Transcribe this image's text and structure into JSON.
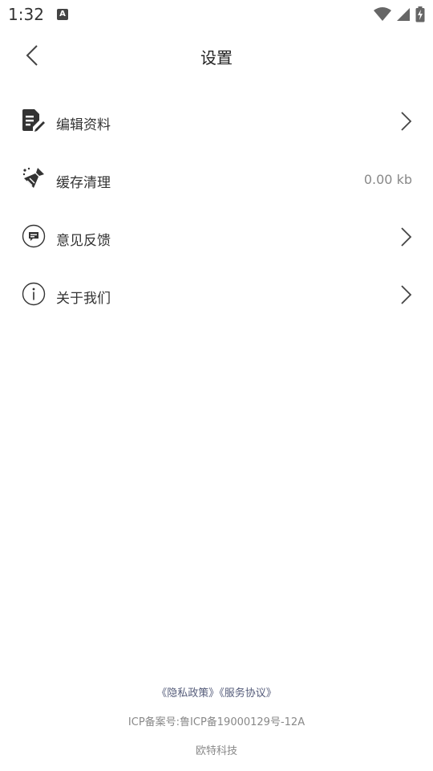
{
  "status_bar": {
    "time": "1:32",
    "notif_letter": "A"
  },
  "header": {
    "title": "设置"
  },
  "menu": [
    {
      "label": "编辑资料",
      "icon": "edit-document-icon",
      "has_arrow": true
    },
    {
      "label": "缓存清理",
      "icon": "broom-icon",
      "value": "0.00 kb",
      "has_arrow": false
    },
    {
      "label": "意见反馈",
      "icon": "feedback-icon",
      "has_arrow": true
    },
    {
      "label": "关于我们",
      "icon": "info-icon",
      "has_arrow": true
    }
  ],
  "footer": {
    "privacy_link": "《隐私政策》",
    "service_link": "《服务协议》",
    "icp": "ICP备案号:鲁ICP备19000129号-12A",
    "company": "欧特科技"
  }
}
